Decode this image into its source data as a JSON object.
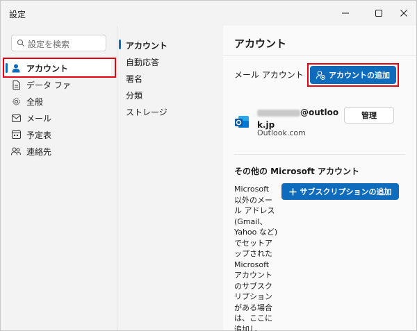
{
  "window": {
    "title": "設定"
  },
  "search": {
    "placeholder": "設定を検索"
  },
  "leftnav": {
    "items": [
      {
        "label": "アカウント"
      },
      {
        "label": "データ ファ"
      },
      {
        "label": "全般"
      },
      {
        "label": "メール"
      },
      {
        "label": "予定表"
      },
      {
        "label": "連絡先"
      }
    ]
  },
  "midnav": {
    "items": [
      {
        "label": "アカウント"
      },
      {
        "label": "自動応答"
      },
      {
        "label": "署名"
      },
      {
        "label": "分類"
      },
      {
        "label": "ストレージ"
      }
    ]
  },
  "content": {
    "title": "アカウント",
    "mail_header": "メール アカウント",
    "add_account_label": "アカウントの追加",
    "account": {
      "email_tail": "@outloo",
      "email_line2": "k.jp",
      "provider": "Outlook.com",
      "manage_label": "管理"
    },
    "other_header": "その他の Microsoft アカウント",
    "other_desc": "Microsoft 以外のメール アドレス (Gmail、Yahoo など) でセットアップされた Microsoft アカウントのサブスクリプションがある場合は、ここに追加し",
    "subscription_label": "サブスクリプションの追加"
  },
  "colors": {
    "accent": "#0f6cbd",
    "highlight": "#e60012"
  }
}
